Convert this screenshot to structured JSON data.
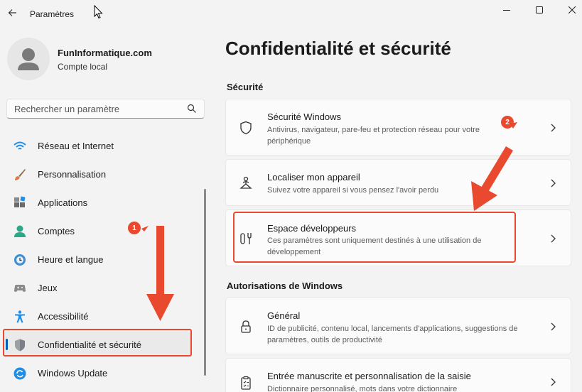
{
  "window": {
    "title": "Paramètres",
    "controls": [
      "minimize",
      "maximize",
      "close"
    ]
  },
  "user": {
    "name": "FunInformatique.com",
    "account_type": "Compte local"
  },
  "search": {
    "placeholder": "Rechercher un paramètre"
  },
  "sidebar": {
    "items": [
      {
        "label": "Réseau et Internet",
        "icon": "wifi-icon"
      },
      {
        "label": "Personnalisation",
        "icon": "paintbrush-icon"
      },
      {
        "label": "Applications",
        "icon": "apps-icon"
      },
      {
        "label": "Comptes",
        "icon": "account-icon"
      },
      {
        "label": "Heure et langue",
        "icon": "globe-clock-icon"
      },
      {
        "label": "Jeux",
        "icon": "gamepad-icon"
      },
      {
        "label": "Accessibilité",
        "icon": "accessibility-icon"
      },
      {
        "label": "Confidentialité et sécurité",
        "icon": "shield-icon",
        "active": true
      },
      {
        "label": "Windows Update",
        "icon": "windows-update-icon"
      }
    ]
  },
  "main": {
    "title": "Confidentialité et sécurité",
    "sections": [
      {
        "title": "Sécurité",
        "cards": [
          {
            "title": "Sécurité Windows",
            "desc": "Antivirus, navigateur, pare-feu et protection réseau pour votre périphérique",
            "icon": "shield-outline-icon"
          },
          {
            "title": "Localiser mon appareil",
            "desc": "Suivez votre appareil si vous pensez l'avoir perdu",
            "icon": "location-person-icon"
          },
          {
            "title": "Espace développeurs",
            "desc": "Ces paramètres sont uniquement destinés à une utilisation de développement",
            "icon": "developer-tools-icon"
          }
        ]
      },
      {
        "title": "Autorisations de Windows",
        "cards": [
          {
            "title": "Général",
            "desc": "ID de publicité, contenu local, lancements d'applications, suggestions de paramètres, outils de productivité",
            "icon": "lock-icon"
          },
          {
            "title": "Entrée manuscrite et personnalisation de la saisie",
            "desc": "Dictionnaire personnalisé, mots dans votre dictionnaire",
            "icon": "clipboard-icon"
          }
        ]
      }
    ]
  },
  "annotations": {
    "badge_1": "1",
    "badge_2": "2",
    "accent_color": "#e8492f",
    "selection_color": "#005fb8"
  }
}
